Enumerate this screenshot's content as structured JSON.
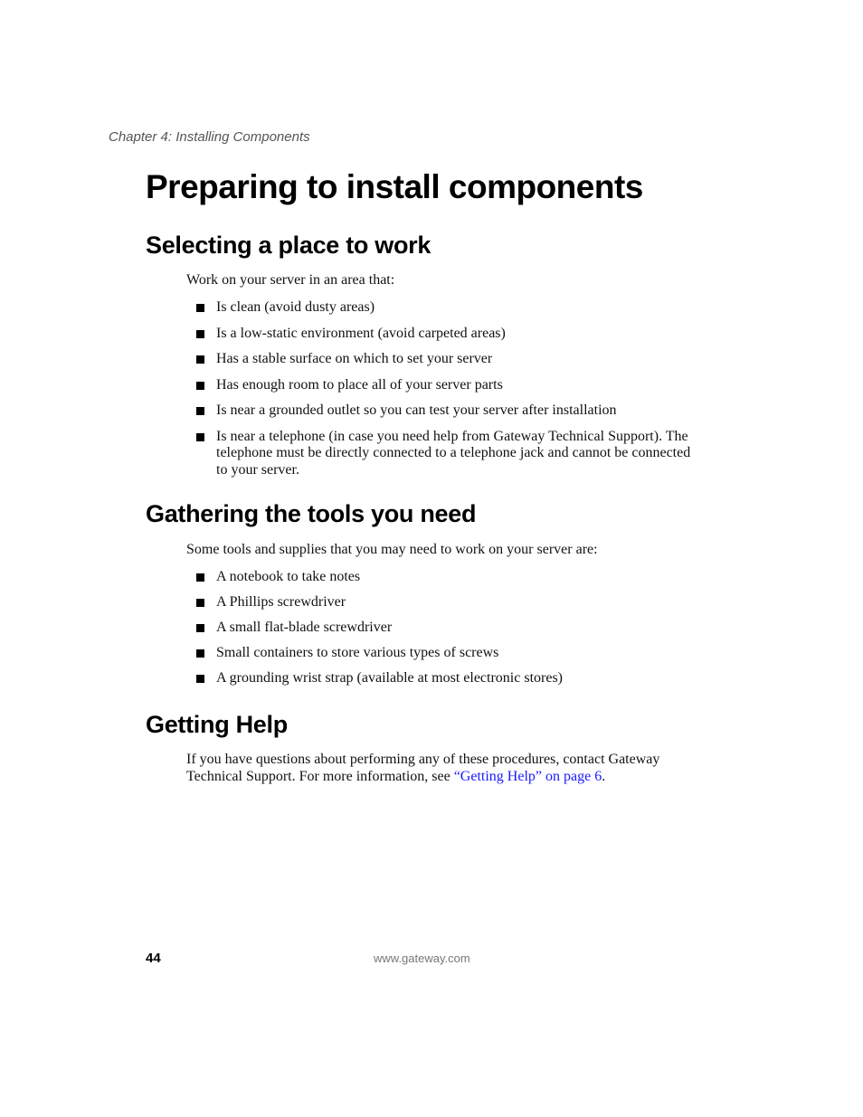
{
  "header": {
    "chapter": "Chapter 4: Installing Components"
  },
  "page_title": "Preparing to install components",
  "sections": [
    {
      "heading": "Selecting a place to work",
      "intro": "Work on your server in an area that:",
      "items": [
        "Is clean (avoid dusty areas)",
        "Is a low-static environment (avoid carpeted areas)",
        "Has a stable surface on which to set your server",
        "Has enough room to place all of your server parts",
        "Is near a grounded outlet so you can test your server after installation",
        "Is near a telephone (in case you need help from Gateway Technical Support). The telephone must be directly connected to a telephone jack and cannot be connected to your server."
      ]
    },
    {
      "heading": "Gathering the tools you need",
      "intro": "Some tools and supplies that you may need to work on your server are:",
      "items": [
        "A notebook to take notes",
        "A Phillips screwdriver",
        "A small flat-blade screwdriver",
        "Small containers to store various types of screws",
        "A grounding wrist strap (available at most electronic stores)"
      ]
    },
    {
      "heading": "Getting Help",
      "text_before_link": "If you have questions about performing any of these procedures, contact Gateway Technical Support. For more information, see ",
      "link_text": "“Getting Help” on page 6",
      "text_after_link": "."
    }
  ],
  "footer": {
    "page_number": "44",
    "url": "www.gateway.com"
  },
  "colors": {
    "link": "#1a1aff",
    "header_text": "#555555"
  }
}
